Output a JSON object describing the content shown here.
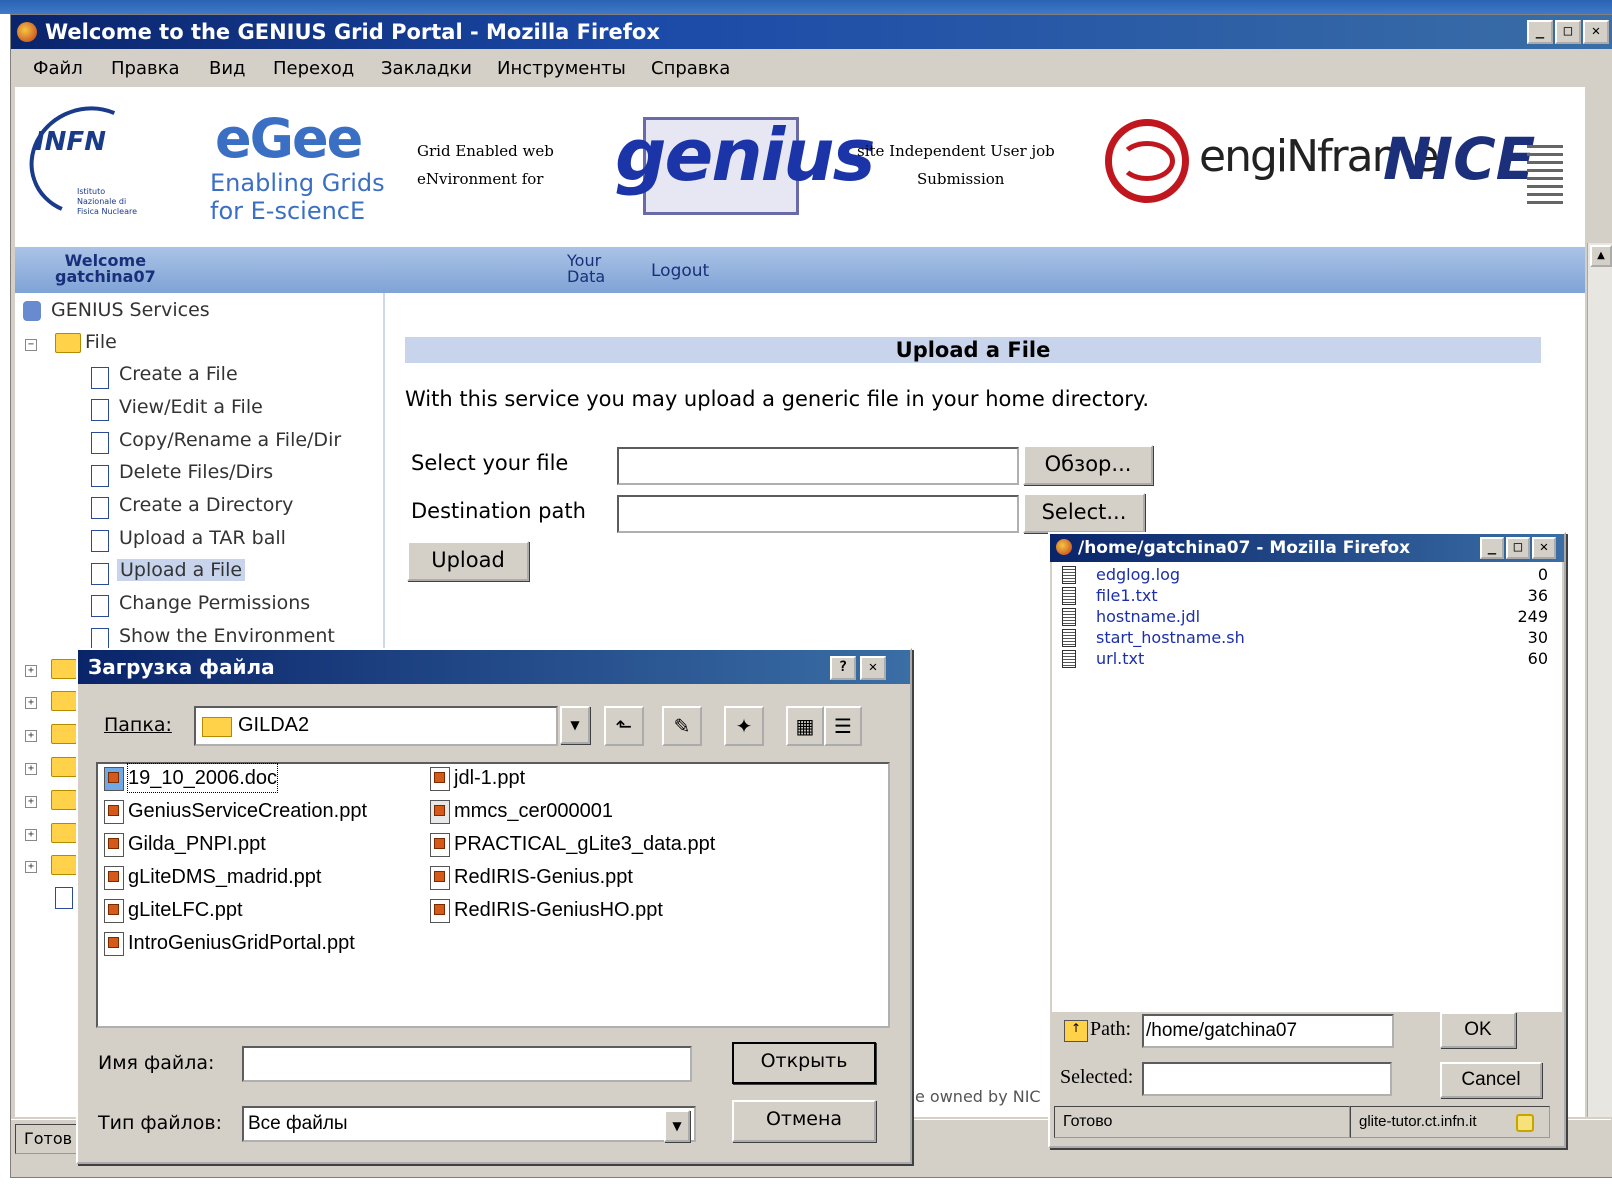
{
  "window": {
    "title": "Welcome to the GENIUS Grid Portal - Mozilla Firefox",
    "menu": [
      "Файл",
      "Правка",
      "Вид",
      "Переход",
      "Закладки",
      "Инструменты",
      "Справка"
    ],
    "status": "Готов"
  },
  "banner": {
    "infn": "INFN",
    "infn_sub": "Istituto Nazionale di Fisica Nucleare",
    "egee": "eGee",
    "egee_sub1": "Enabling Grids",
    "egee_sub2": "for E-sciencE",
    "grid_line1": "Grid Enabled web",
    "grid_line2": "eNvironment for",
    "genius": "genius",
    "site_line1": "site Independent User job",
    "site_line2": "Submission",
    "enginframe": "engiNframe",
    "nice": "NICE"
  },
  "nav": {
    "welcome": "Welcome",
    "user": "gatchina07",
    "your": "Your",
    "data": "Data",
    "logout": "Logout"
  },
  "sidebar": {
    "root": "GENIUS Services",
    "folder": "File",
    "items": [
      "Create a File",
      "View/Edit a File",
      "Copy/Rename a File/Dir",
      "Delete Files/Dirs",
      "Create a Directory",
      "Upload a TAR ball",
      "Upload a File",
      "Change Permissions",
      "Show the Environment"
    ]
  },
  "main": {
    "heading": "Upload a File",
    "description": "With this service you may upload a generic file in your home directory.",
    "select_label": "Select your file",
    "browse_button": "Обзор...",
    "dest_label": "Destination path",
    "select_button": "Select...",
    "upload_button": "Upload",
    "footer_fragment": "e owned by NIC"
  },
  "upload_dialog": {
    "title": "Загрузка файла",
    "help": "?",
    "close": "✕",
    "folder_label": "Папка:",
    "folder_value": "GILDA2",
    "files_col1": [
      "19_10_2006.doc",
      "GeniusServiceCreation.ppt",
      "Gilda_PNPI.ppt",
      "gLiteDMS_madrid.ppt",
      "gLiteLFC.ppt",
      "IntroGeniusGridPortal.ppt"
    ],
    "files_col2": [
      "jdl-1.ppt",
      "mmcs_cer000001",
      "PRACTICAL_gLite3_data.ppt",
      "RedIRIS-Genius.ppt",
      "RedIRIS-GeniusHO.ppt"
    ],
    "filename_label": "Имя файла:",
    "filename_value": "",
    "filetype_label": "Тип файлов:",
    "filetype_value": "Все файлы",
    "open_button": "Открыть",
    "cancel_button": "Отмена"
  },
  "popup": {
    "title": "/home/gatchina07 - Mozilla Firefox",
    "files": [
      {
        "name": "edglog.log",
        "size": "0"
      },
      {
        "name": "file1.txt",
        "size": "36"
      },
      {
        "name": "hostname.jdl",
        "size": "249"
      },
      {
        "name": "start_hostname.sh",
        "size": "30"
      },
      {
        "name": "url.txt",
        "size": "60"
      }
    ],
    "path_label": "Path:",
    "path_value": "/home/gatchina07",
    "ok_button": "OK",
    "selected_label": "Selected:",
    "selected_value": "",
    "cancel_button": "Cancel",
    "status": "Готово",
    "host": "glite-tutor.ct.infn.it"
  }
}
